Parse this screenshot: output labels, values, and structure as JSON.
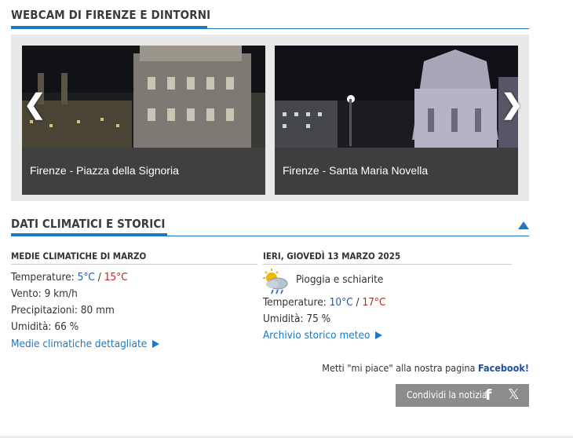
{
  "webcam_section": {
    "title": "WEBCAM DI FIRENZE E DINTORNI",
    "prev_arrow": "❮",
    "next_arrow": "❯",
    "cams": [
      {
        "caption": "Firenze - Piazza della Signoria"
      },
      {
        "caption": "Firenze - Santa Maria Novella"
      }
    ]
  },
  "climate_section": {
    "title": "DATI CLIMATICI E STORICI",
    "averages": {
      "heading": "MEDIE CLIMATICHE DI MARZO",
      "temp_label": "Temperature: ",
      "temp_min": "5°C",
      "sep": " / ",
      "temp_max": "15°C",
      "wind": "Vento: 9 km/h",
      "precip": "Precipitazioni: 80 mm",
      "humidity": "Umidità: 66 %",
      "link": "Medie climatiche dettagliate"
    },
    "yesterday": {
      "heading": "IERI, GIOVEDÌ 13 MARZO 2025",
      "condition": "Pioggia e schiarite",
      "temp_label": "Temperature: ",
      "temp_min": "10°C",
      "sep": " / ",
      "temp_max": "17°C",
      "humidity": "Umidità: 75 %",
      "link": "Archivio storico meteo"
    }
  },
  "social": {
    "like_text": "Metti \"mi piace\" alla nostra pagina ",
    "like_brand": "Facebook!",
    "share_label": "Condividi la notizia",
    "fb_icon": "f",
    "x_icon": "𝕏"
  },
  "colors": {
    "accent": "#1e78c2",
    "cold": "#1e5bb5",
    "hot": "#c0232a"
  }
}
